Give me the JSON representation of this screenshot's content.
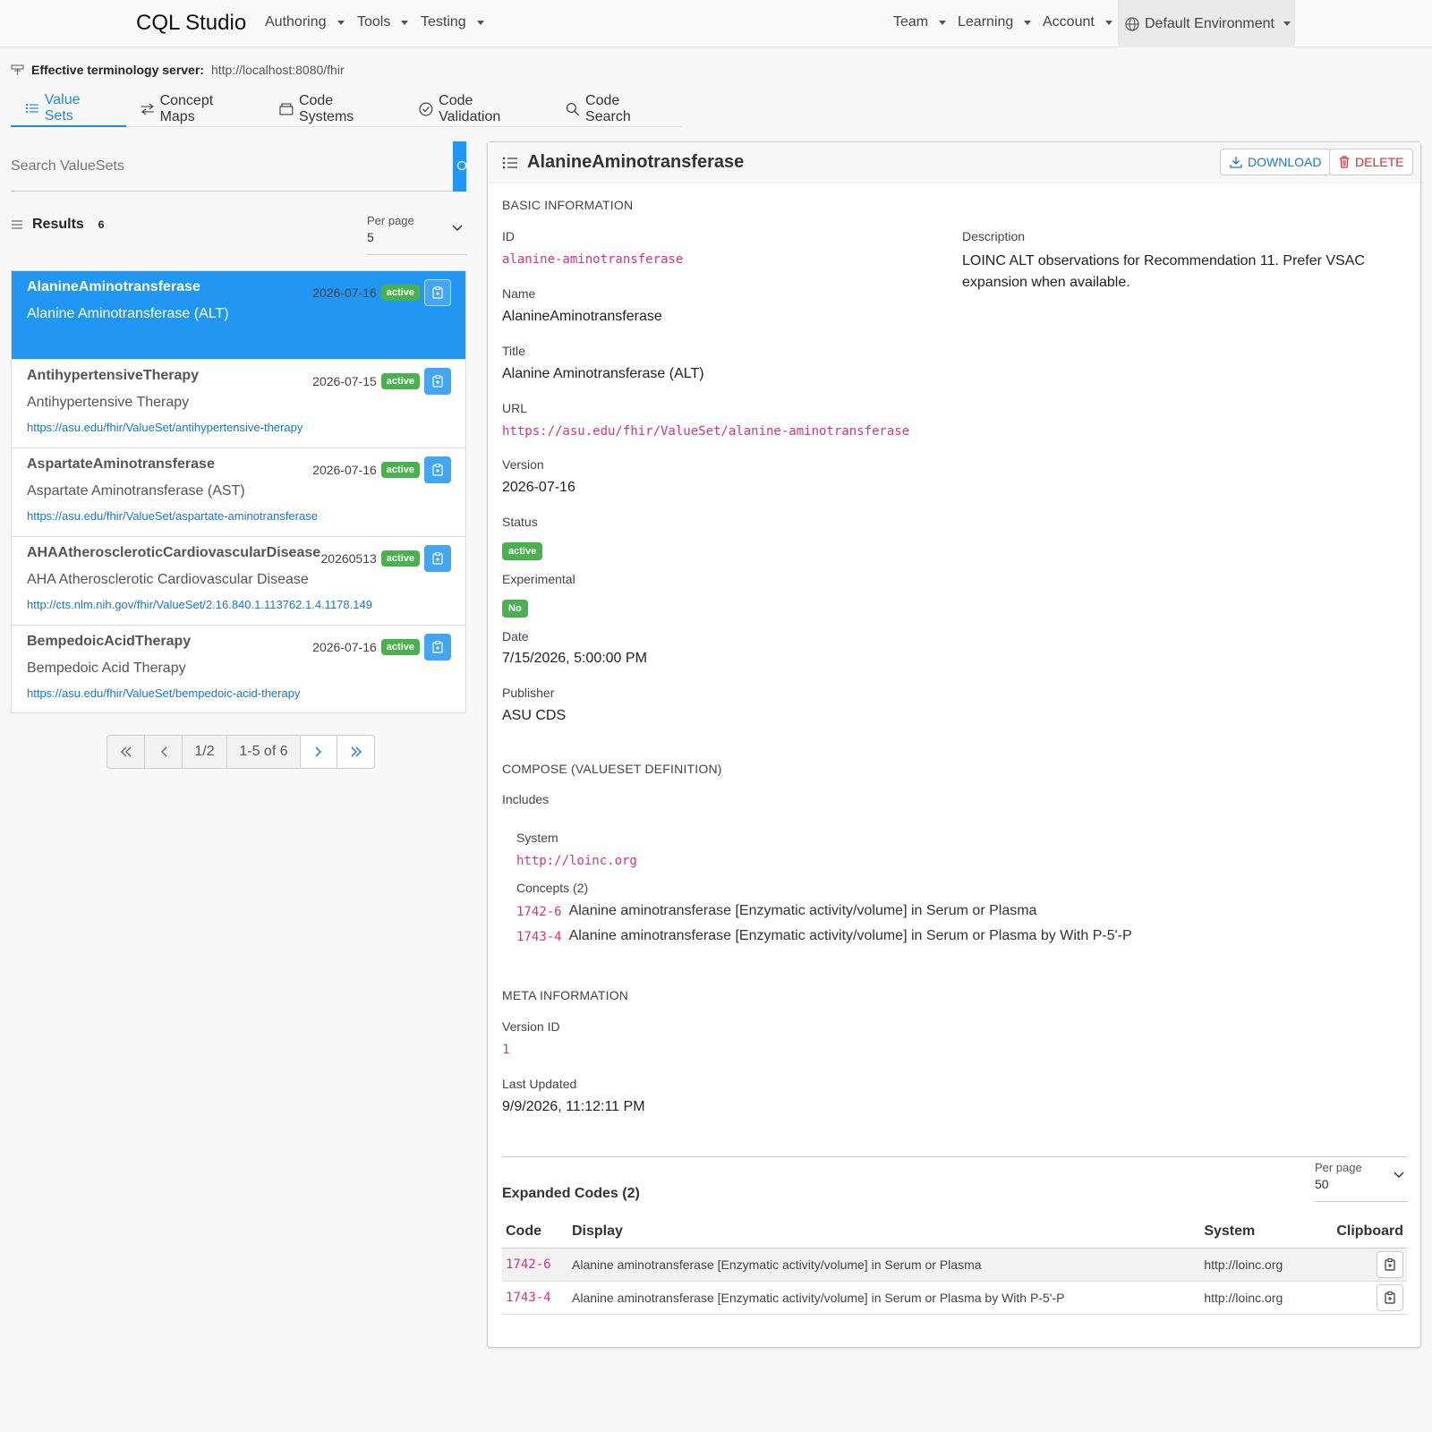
{
  "nav": {
    "brand": "CQL Studio",
    "left_items": [
      "Authoring",
      "Tools",
      "Testing"
    ],
    "right_items": [
      "Team",
      "Learning",
      "Account"
    ],
    "environment": "Default Environment"
  },
  "terminology": {
    "label": "Effective terminology server:",
    "url": "http://localhost:8080/fhir"
  },
  "tabs": [
    {
      "label": "Value Sets",
      "icon": "list-icon",
      "active": true
    },
    {
      "label": "Concept Maps",
      "icon": "arrows-exchange-icon",
      "active": false
    },
    {
      "label": "Code Systems",
      "icon": "box-icon",
      "active": false
    },
    {
      "label": "Code Validation",
      "icon": "check-circle-icon",
      "active": false
    },
    {
      "label": "Code Search",
      "icon": "search-icon",
      "active": false
    }
  ],
  "search": {
    "placeholder": "Search ValueSets",
    "value": ""
  },
  "results": {
    "label": "Results",
    "count": "6"
  },
  "per_page_left": {
    "label": "Per page",
    "value": "5"
  },
  "valuesets": [
    {
      "name": "AlanineAminotransferase",
      "title": "Alanine Aminotransferase (ALT)",
      "url": "",
      "date": "2026-07-16",
      "status": "active"
    },
    {
      "name": "AntihypertensiveTherapy",
      "title": "Antihypertensive Therapy",
      "url": "https://asu.edu/fhir/ValueSet/antihypertensive-therapy",
      "date": "2026-07-15",
      "status": "active"
    },
    {
      "name": "AspartateAminotransferase",
      "title": "Aspartate Aminotransferase (AST)",
      "url": "https://asu.edu/fhir/ValueSet/aspartate-aminotransferase",
      "date": "2026-07-16",
      "status": "active"
    },
    {
      "name": "AHAAtheroscleroticCardiovascularDisease",
      "title": "AHA Atherosclerotic Cardiovascular Disease",
      "url": "http://cts.nlm.nih.gov/fhir/ValueSet/2.16.840.1.113762.1.4.1178.149",
      "date": "20260513",
      "status": "active"
    },
    {
      "name": "BempedoicAcidTherapy",
      "title": "Bempedoic Acid Therapy",
      "url": "https://asu.edu/fhir/ValueSet/bempedoic-acid-therapy",
      "date": "2026-07-16",
      "status": "active"
    }
  ],
  "pagination": {
    "page": "1/2",
    "range": "1-5 of 6"
  },
  "detail": {
    "title": "AlanineAminotransferase",
    "download_label": "DOWNLOAD",
    "delete_label": "DELETE",
    "basic_section": "BASIC INFORMATION",
    "id_label": "ID",
    "id": "alanine-aminotransferase",
    "description_label": "Description",
    "description": "LOINC ALT observations for Recommendation 11. Prefer VSAC expansion when available.",
    "name_label": "Name",
    "name": "AlanineAminotransferase",
    "title_label": "Title",
    "title_value": "Alanine Aminotransferase (ALT)",
    "url_label": "URL",
    "url": "https://asu.edu/fhir/ValueSet/alanine-aminotransferase",
    "version_label": "Version",
    "version": "2026-07-16",
    "status_label": "Status",
    "status": "active",
    "experimental_label": "Experimental",
    "experimental": "No",
    "date_label": "Date",
    "date": "7/15/2026, 5:00:00 PM",
    "publisher_label": "Publisher",
    "publisher": "ASU CDS",
    "compose_section": "COMPOSE (VALUESET DEFINITION)",
    "includes_label": "Includes",
    "system_label": "System",
    "system": "http://loinc.org",
    "concepts_label": "Concepts (2)",
    "concepts": [
      {
        "code": "1742-6",
        "display": "Alanine aminotransferase [Enzymatic activity/volume] in Serum or Plasma"
      },
      {
        "code": "1743-4",
        "display": "Alanine aminotransferase [Enzymatic activity/volume] in Serum or Plasma by With P-5'-P"
      }
    ],
    "meta_section": "META INFORMATION",
    "version_id_label": "Version ID",
    "version_id": "1",
    "last_updated_label": "Last Updated",
    "last_updated": "9/9/2026, 11:12:11 PM"
  },
  "expanded": {
    "title": "Expanded Codes (2)",
    "per_page_label": "Per page",
    "per_page_value": "50",
    "columns": [
      "Code",
      "Display",
      "System",
      "Clipboard"
    ],
    "rows": [
      {
        "code": "1742-6",
        "display": "Alanine aminotransferase [Enzymatic activity/volume] in Serum or Plasma",
        "system": "http://loinc.org"
      },
      {
        "code": "1743-4",
        "display": "Alanine aminotransferase [Enzymatic activity/volume] in Serum or Plasma by With P-5'-P",
        "system": "http://loinc.org"
      }
    ]
  },
  "colors": {
    "accent": "#2196f3",
    "status_green": "#4caf50",
    "code_pink": "#d63384",
    "delete_red": "#d32f2f"
  }
}
